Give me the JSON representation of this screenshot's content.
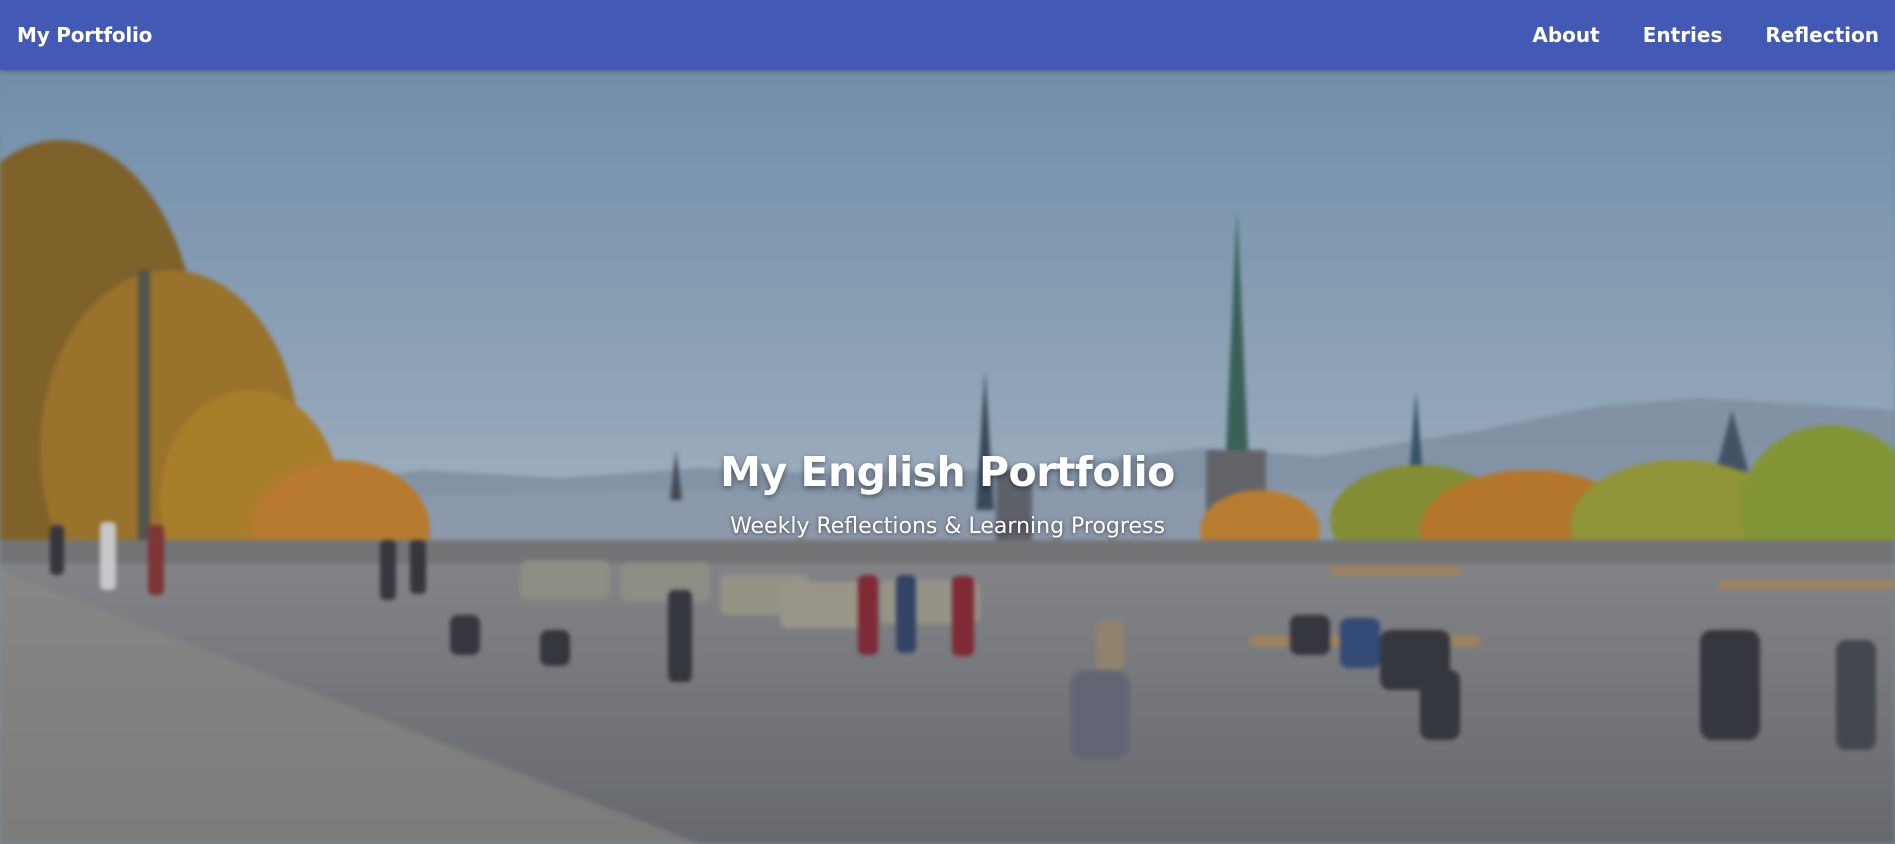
{
  "navbar": {
    "brand": "My Portfolio",
    "links": [
      {
        "label": "About"
      },
      {
        "label": "Entries"
      },
      {
        "label": "Reflection"
      }
    ],
    "background_color": "#4259b6"
  },
  "hero": {
    "title": "My English Portfolio",
    "subtitle": "Weekly Reflections & Learning Progress",
    "background_image": "blurred city plaza with church spires, mountains and autumn trees"
  }
}
